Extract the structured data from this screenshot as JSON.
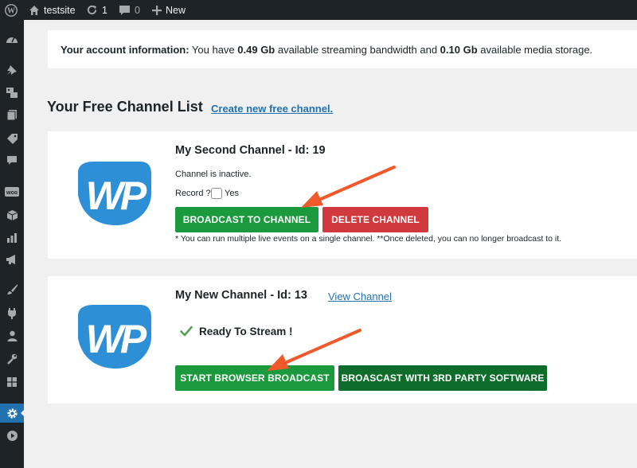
{
  "adminbar": {
    "site_name": "testsite",
    "updates_count": "1",
    "comments_count": "0",
    "new_label": "New"
  },
  "notice": {
    "prefix": "Your account information:",
    "text1": " You have ",
    "bandwidth": "0.49 Gb",
    "text2": " available streaming bandwidth and ",
    "storage": "0.10 Gb",
    "text3": " available media storage."
  },
  "section": {
    "title": "Your Free Channel List",
    "create_link": "Create new free channel."
  },
  "channels": [
    {
      "title": "My Second Channel - Id: 19",
      "status": "Channel is inactive.",
      "record_label": "Record ?",
      "record_option": "Yes",
      "broadcast_button": "BROADCAST TO CHANNEL",
      "delete_button": "DELETE CHANNEL",
      "note": "* You can run multiple live events on a single channel. **Once deleted, you can no longer broadcast to it."
    },
    {
      "title": "My New Channel - Id: 13",
      "view_link": "View Channel",
      "ready_text": "Ready To Stream !",
      "browser_button": "START BROWSER BROADCAST",
      "software_button": "BROASCAST WITH 3RD PARTY SOFTWARE"
    }
  ],
  "logo": {
    "text": "WP"
  },
  "colors": {
    "admin_dark": "#1d2327",
    "link_blue": "#2271b1",
    "button_green": "#1a9a3d",
    "button_dark_green": "#0f6d2c",
    "button_red": "#d0393e",
    "arrow_red": "#f05a2a",
    "logo_blue": "#2d8fd5"
  },
  "icons": {
    "adminbar": [
      "wordpress-logo-icon",
      "home-icon",
      "updates-icon",
      "comments-icon",
      "plus-icon"
    ],
    "sidebar": [
      "dashboard-icon",
      "pin-icon",
      "media-icon",
      "pages-icon",
      "tag-icon",
      "comments-icon",
      "woocommerce-icon",
      "box-icon",
      "analytics-icon",
      "megaphone-icon",
      "brush-icon",
      "plugin-icon",
      "user-icon",
      "wrench-icon",
      "table-icon",
      "settings-icon",
      "play-icon"
    ]
  }
}
